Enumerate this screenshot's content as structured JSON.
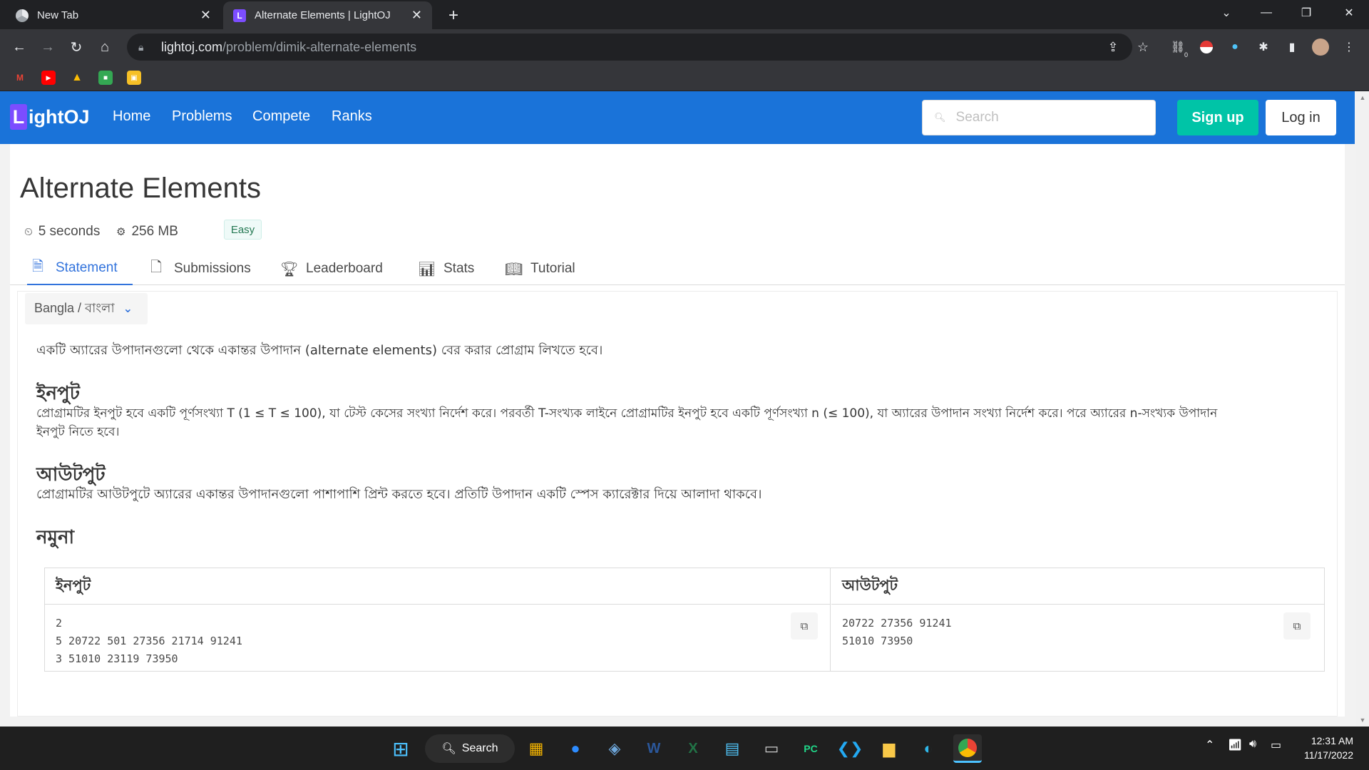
{
  "browser": {
    "tabs": [
      {
        "title": "New Tab"
      },
      {
        "title": "Alternate Elements | LightOJ"
      }
    ],
    "close_glyph": "✕",
    "new_tab_glyph": "+",
    "url": {
      "host": "lightoj.com",
      "path": "/problem/dimik-alternate-elements"
    },
    "ext_badge": "0"
  },
  "site": {
    "logo_mark": "L",
    "logo_text": "ightOJ",
    "nav": [
      "Home",
      "Problems",
      "Compete",
      "Ranks"
    ],
    "search_placeholder": "Search",
    "signup": "Sign up",
    "login": "Log in"
  },
  "problem": {
    "title": "Alternate Elements",
    "time_limit": "5 seconds",
    "memory_limit": "256 MB",
    "difficulty": "Easy",
    "tabs": [
      "Statement",
      "Submissions",
      "Leaderboard",
      "Stats",
      "Tutorial"
    ],
    "language": "Bangla / বাংলা",
    "intro": "একটি অ্যারের উপাদানগুলো থেকে একান্তর উপাদান (alternate elements) বের করার প্রোগ্রাম লিখতে হবে।",
    "input_heading": "ইনপুট",
    "input_text_1": "প্রোগ্রামটির ইনপুট হবে একটি পূর্ণসংখ্যা T (1 ≤ T ≤ 100), যা টেস্ট কেসের সংখ্যা নির্দেশ করে। পরবর্তী T-সংখ্যক লাইনে প্রোগ্রামটির ইনপুট হবে একটি পূর্ণসংখ্যা n (≤ 100), যা অ্যারের উপাদান সংখ্যা নির্দেশ করে। পরে অ্যারের n-সংখ্যক উপাদান",
    "input_text_2": "ইনপুট নিতে হবে।",
    "output_heading": "আউটপুট",
    "output_text": "প্রোগ্রামটির আউটপুটে অ্যারের একান্তর উপাদানগুলো পাশাপাশি প্রিন্ট করতে হবে। প্রতিটি উপাদান একটি স্পেস ক্যারেক্টার দিয়ে আলাদা থাকবে।",
    "sample_heading": "নমুনা",
    "sample": {
      "input_header": "ইনপুট",
      "output_header": "আউটপুট",
      "input": "2\n5 20722 501 27356 21714 91241\n3 51010 23119 73950",
      "output": "20722 27356 91241\n51010 73950"
    }
  },
  "taskbar": {
    "search": "Search",
    "time": "12:31 AM",
    "date": "11/17/2022"
  },
  "colors": {
    "site_bar": "#1a73d9",
    "signup": "#00c4a7",
    "active_tab": "#3273dc",
    "logo_mark": "#7c4dff"
  }
}
